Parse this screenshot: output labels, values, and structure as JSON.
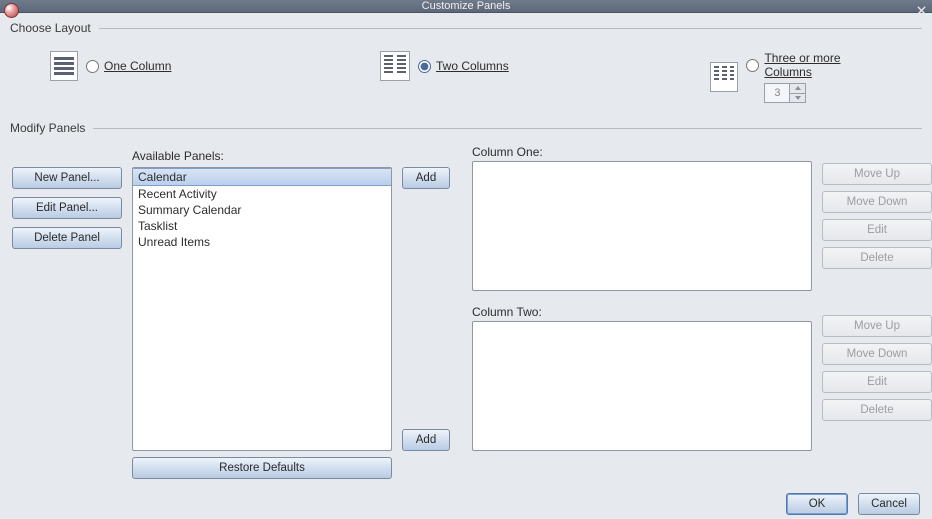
{
  "window": {
    "title": "Customize Panels"
  },
  "groups": {
    "choose": "Choose Layout",
    "modify": "Modify Panels"
  },
  "layout": {
    "one": {
      "label": "One Column",
      "value": "one"
    },
    "two": {
      "label": "Two Columns",
      "value": "two"
    },
    "three": {
      "label": "Three or more Columns",
      "value": "three",
      "count": "3"
    },
    "selected": "two"
  },
  "panels": {
    "available_label": "Available Panels:",
    "available": [
      "Calendar",
      "Recent Activity",
      "Summary Calendar",
      "Tasklist",
      "Unread Items"
    ],
    "selected_index": 0,
    "column_one_label": "Column One:",
    "column_one": [],
    "column_two_label": "Column Two:",
    "column_two": []
  },
  "buttons": {
    "new_panel": "New Panel...",
    "edit_panel": "Edit Panel...",
    "delete_panel": "Delete Panel",
    "add": "Add",
    "move_up": "Move Up",
    "move_down": "Move Down",
    "edit": "Edit",
    "delete": "Delete",
    "restore": "Restore Defaults",
    "ok": "OK",
    "cancel": "Cancel"
  }
}
